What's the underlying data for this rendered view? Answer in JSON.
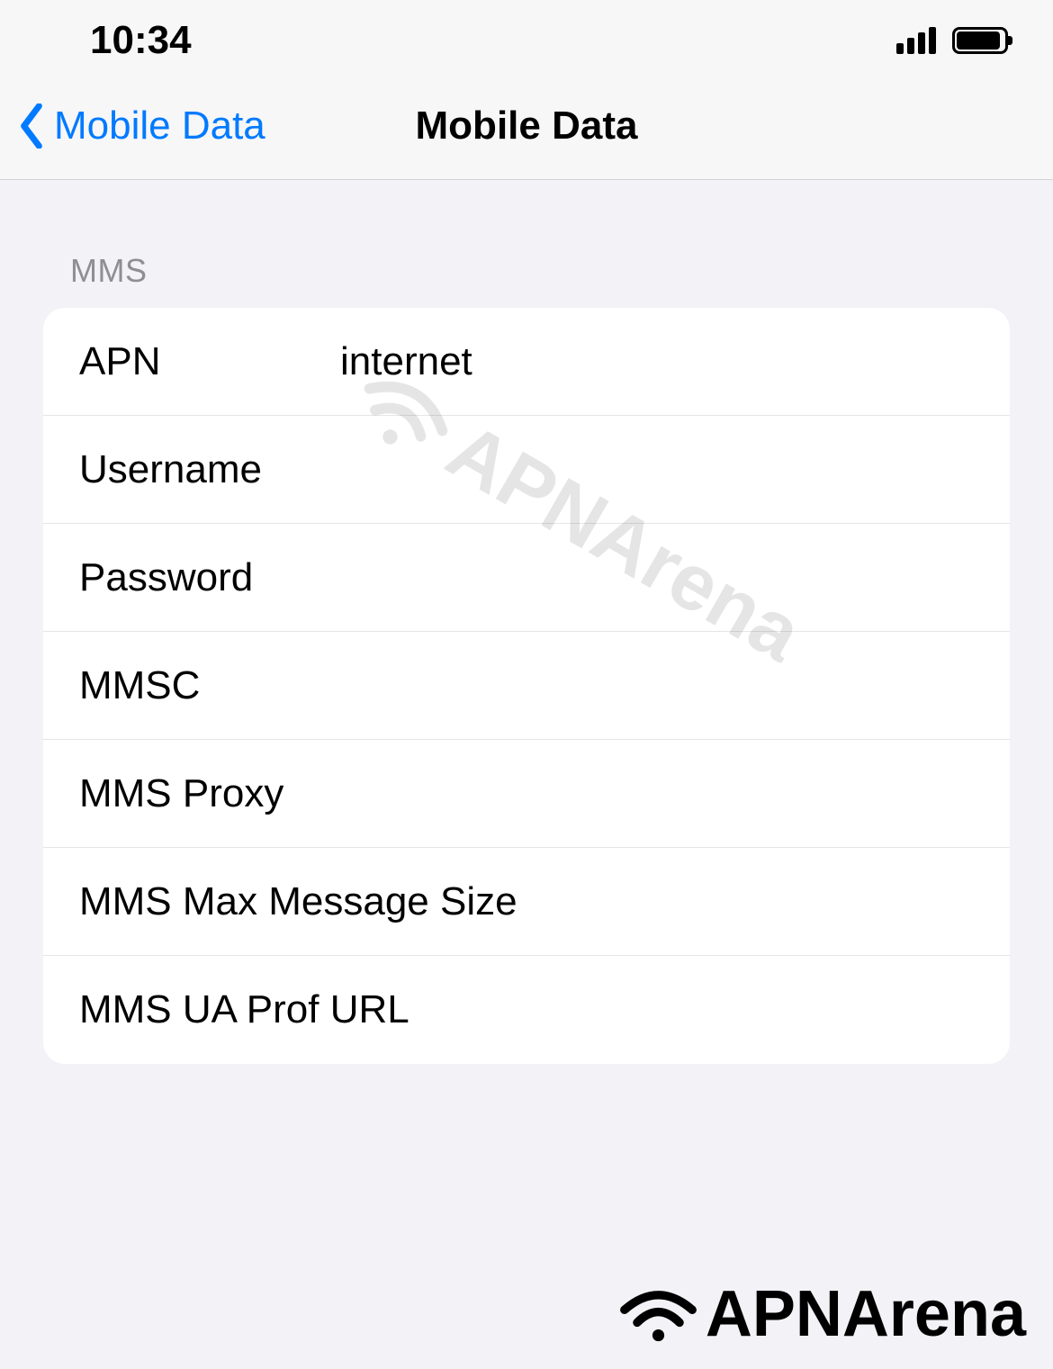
{
  "statusBar": {
    "time": "10:34"
  },
  "navBar": {
    "backLabel": "Mobile Data",
    "title": "Mobile Data"
  },
  "section": {
    "header": "MMS",
    "rows": [
      {
        "label": "APN",
        "value": "internet"
      },
      {
        "label": "Username",
        "value": ""
      },
      {
        "label": "Password",
        "value": ""
      },
      {
        "label": "MMSC",
        "value": ""
      },
      {
        "label": "MMS Proxy",
        "value": ""
      },
      {
        "label": "MMS Max Message Size",
        "value": ""
      },
      {
        "label": "MMS UA Prof URL",
        "value": ""
      }
    ]
  },
  "watermark": {
    "text": "APNArena"
  },
  "footer": {
    "logoText": "APNArena"
  }
}
